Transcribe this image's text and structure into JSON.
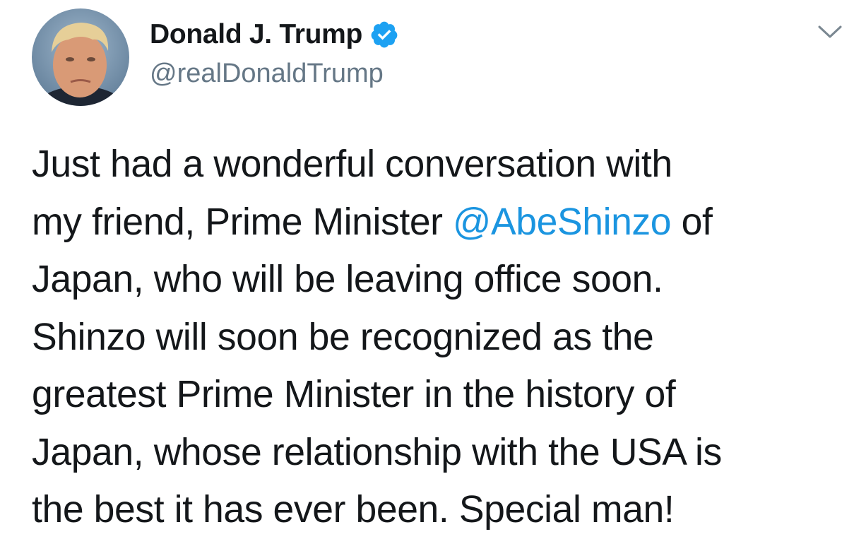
{
  "tweet": {
    "author": {
      "display_name": "Donald J. Trump",
      "handle": "@realDonaldTrump",
      "verified_icon": "verified-badge-icon",
      "avatar_icon": "profile-avatar"
    },
    "menu_icon": "chevron-down-icon",
    "body": {
      "lines": [
        "Just had a wonderful conversation with",
        "my friend, Prime Minister ",
        "@AbeShinzo",
        " of",
        "Japan, who will be leaving office soon.",
        "Shinzo will soon be recognized as the",
        "greatest Prime Minister in the history of",
        "Japan, whose relationship with the USA is",
        "the best it has ever been. Special man!"
      ]
    }
  },
  "colors": {
    "text": "#14171a",
    "secondary": "#657786",
    "link": "#1b95e0",
    "verified": "#1da1f2"
  }
}
